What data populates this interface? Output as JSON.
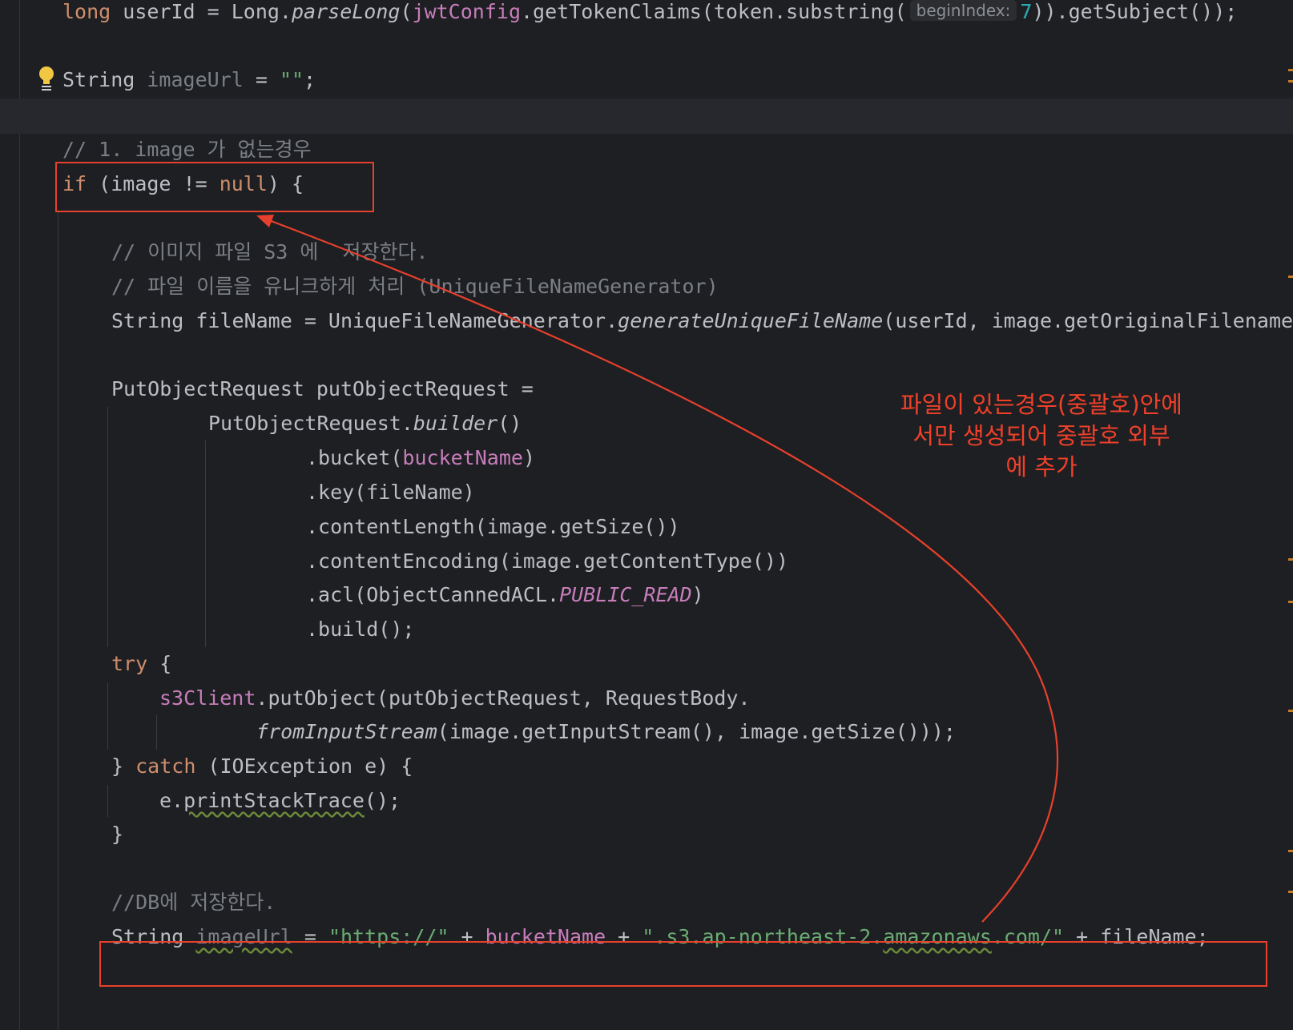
{
  "editor": {
    "lines": {
      "l1": {
        "t1": "long",
        "t2": " userId = Long.",
        "t3": "parseLong",
        "t4": "(",
        "t5": "jwtConfig",
        "t6": ".getTokenClaims(token.substring(",
        "hint": "beginIndex:",
        "t7": "7",
        "t8": ")).getSubject());"
      },
      "l2": {
        "t1": "String ",
        "t2": "imageUrl",
        "t3": " = ",
        "t4": "\"\"",
        "t5": ";"
      },
      "l3": {
        "t1": "// 1. image 가 없는경우"
      },
      "l4": {
        "t1": "if",
        "t2": " (image != ",
        "t3": "null",
        "t4": ") {"
      },
      "l5": {
        "t1": "// 이미지 파일 S3 에  저장한다."
      },
      "l6": {
        "t1": "// 파일 이름을 유니크하게 처리 (UniqueFileNameGenerator)"
      },
      "l7": {
        "t1": "String fileName = UniqueFileNameGenerator.",
        "t2": "generateUniqueFileName",
        "t3": "(userId, image.getOriginalFilename());"
      },
      "l8": {
        "t1": "PutObjectRequest putObjectRequest ="
      },
      "l9": {
        "t1": "PutObjectRequest.",
        "t2": "builder",
        "t3": "()"
      },
      "l10": {
        "t1": ".bucket(",
        "t2": "bucketName",
        "t3": ")"
      },
      "l11": {
        "t1": ".key(fileName)"
      },
      "l12": {
        "t1": ".contentLength(image.getSize())"
      },
      "l13": {
        "t1": ".contentEncoding(image.getContentType())"
      },
      "l14": {
        "t1": ".acl(ObjectCannedACL.",
        "t2": "PUBLIC_READ",
        "t3": ")"
      },
      "l15": {
        "t1": ".build();"
      },
      "l16": {
        "t1": "try",
        "t2": " {"
      },
      "l17": {
        "t1": "s3Client",
        "t2": ".putObject(putObjectRequest, RequestBody."
      },
      "l18": {
        "t1": "fromInputStream",
        "t2": "(image.getInputStream(), image.getSize()));"
      },
      "l19": {
        "t1": "} ",
        "t2": "catch",
        "t3": " (IOException e) {"
      },
      "l20": {
        "t1": "e.",
        "t2": "printStackTrace",
        "t3": "();"
      },
      "l21": {
        "t1": "}"
      },
      "l22": {
        "t1": "//DB에 저장한다."
      },
      "l23": {
        "t1": "String ",
        "t2": "imageUrl",
        "t3": " = ",
        "t4": "\"https://\"",
        "t5": " + ",
        "t6": "bucketName",
        "t7": " + ",
        "t8": "\".s3.ap-northeast-2.",
        "t9": "amazonaws",
        "t10": ".com/\"",
        "t11": " + fileName;"
      }
    },
    "annotation": "파일이 있는경우(중괄호)안에\n서만 생성되어  중괄호 외부\n에 추가",
    "icons": {
      "bulb": "lightbulb-icon"
    },
    "colors": {
      "background": "#1e1f22",
      "keyword": "#cf8e6d",
      "field": "#c77dbb",
      "string": "#6aab73",
      "number": "#2aacb8",
      "comment": "#7a7e85",
      "annotation": "#e7402c"
    }
  }
}
